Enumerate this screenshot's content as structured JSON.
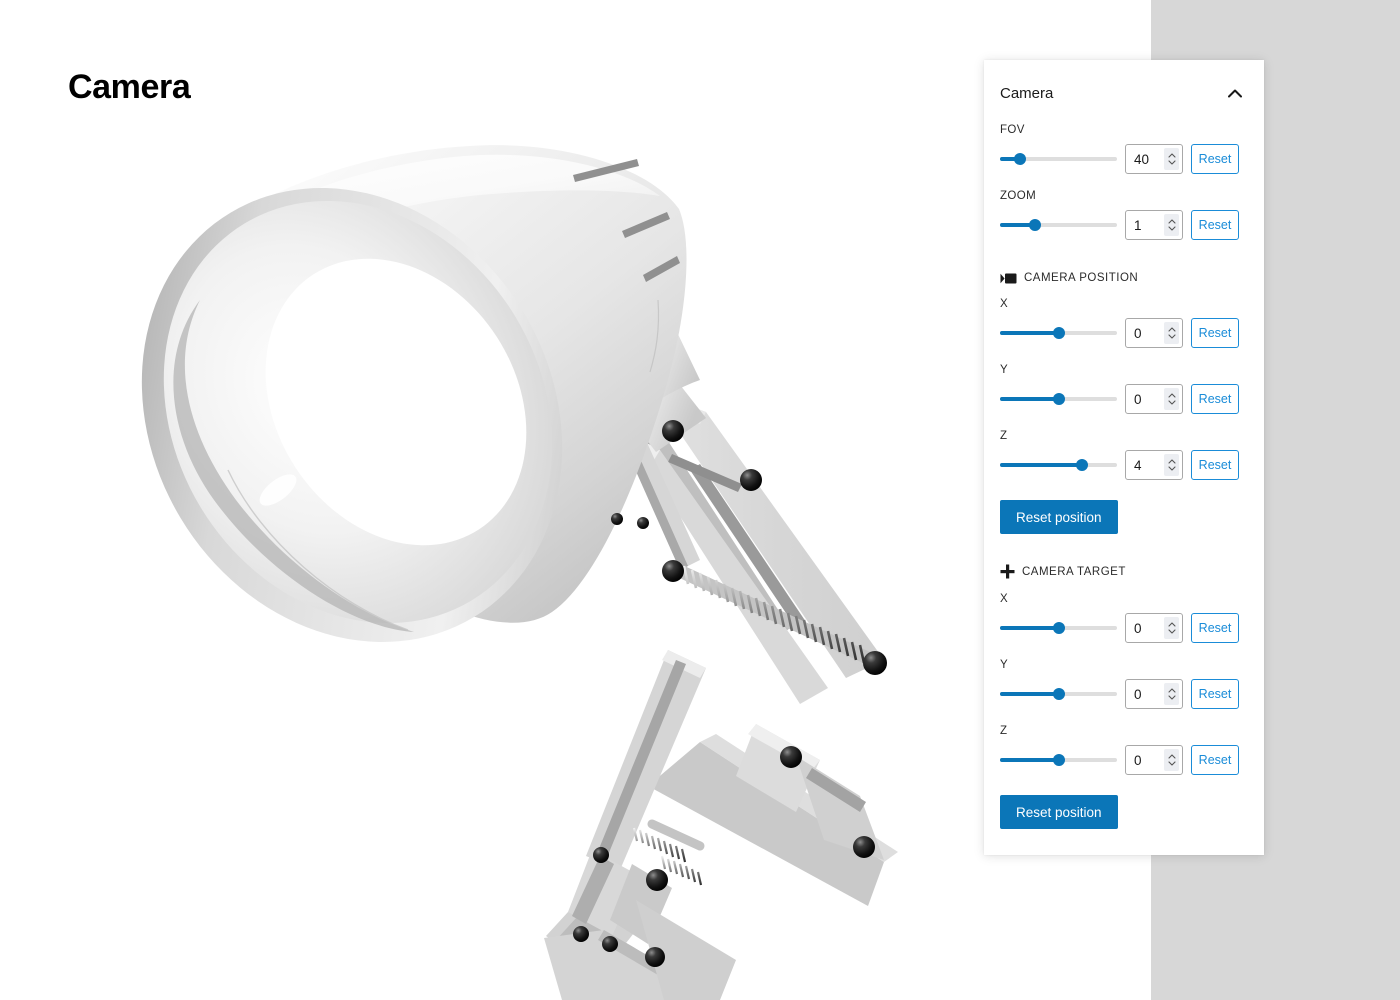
{
  "page": {
    "title": "Camera",
    "background_color": "#ffffff",
    "side_panel_background": "#d7d7d7",
    "accent_color": "#0b76b8",
    "reset_link_color": "#1a8cd8"
  },
  "viewport": {
    "model_name": "desk-lamp-3d-model",
    "description": "3D rendered white articulated desk lamp with conical shade, parallel arm linkage and coil springs"
  },
  "panel": {
    "title": "Camera",
    "collapse_icon": "chevron-up-icon",
    "fov": {
      "label": "FOV",
      "value": "40",
      "slider_percent": 17
    },
    "zoom": {
      "label": "ZOOM",
      "value": "1",
      "slider_percent": 30
    },
    "camera_position": {
      "icon": "video-camera-icon",
      "label": "CAMERA POSITION",
      "reset_button": "Reset position",
      "axes": [
        {
          "label": "X",
          "value": "0",
          "slider_percent": 50,
          "reset": "Reset"
        },
        {
          "label": "Y",
          "value": "0",
          "slider_percent": 50,
          "reset": "Reset"
        },
        {
          "label": "Z",
          "value": "4",
          "slider_percent": 70,
          "reset": "Reset"
        }
      ]
    },
    "camera_target": {
      "icon": "plus-icon",
      "label": "CAMERA TARGET",
      "reset_button": "Reset position",
      "axes": [
        {
          "label": "X",
          "value": "0",
          "slider_percent": 50,
          "reset": "Reset"
        },
        {
          "label": "Y",
          "value": "0",
          "slider_percent": 50,
          "reset": "Reset"
        },
        {
          "label": "Z",
          "value": "0",
          "slider_percent": 50,
          "reset": "Reset"
        }
      ]
    },
    "reset_label": "Reset"
  }
}
